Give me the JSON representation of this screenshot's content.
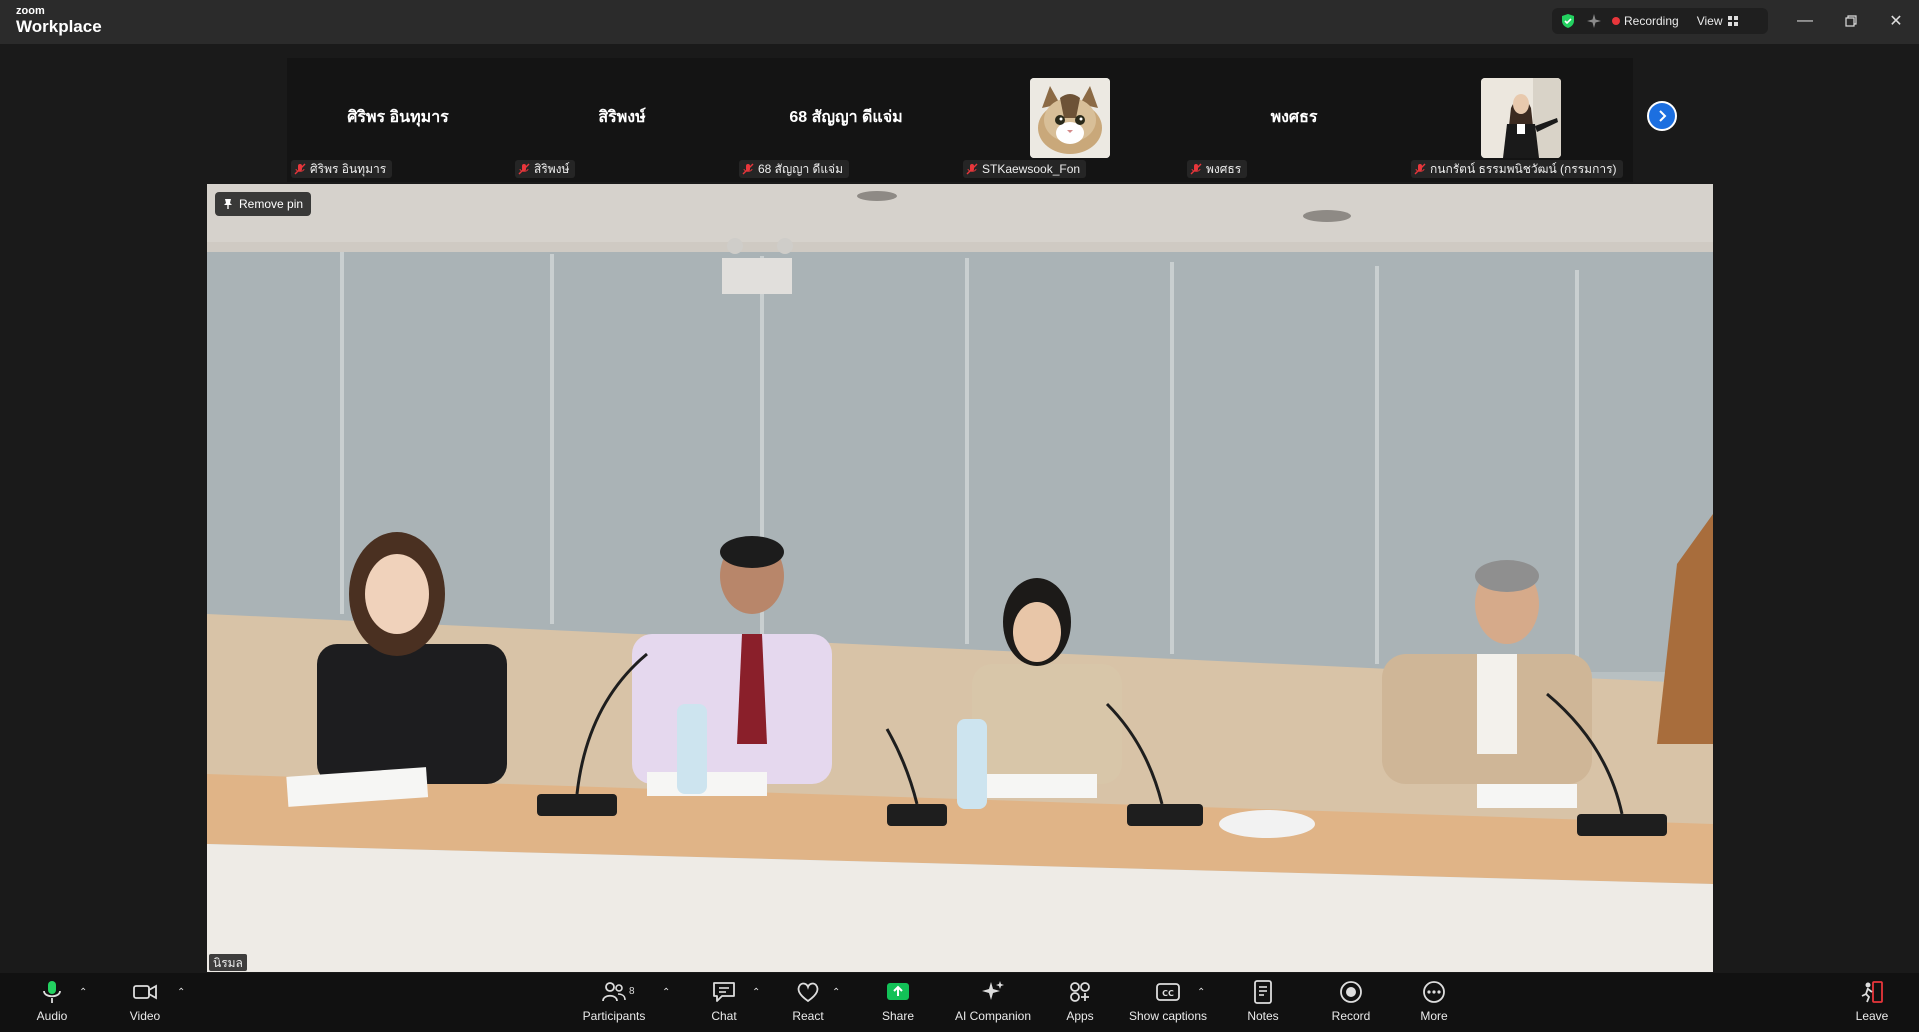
{
  "app": {
    "brand_small": "zoom",
    "brand_big": "Workplace"
  },
  "header": {
    "recording_label": "Recording",
    "view_label": "View"
  },
  "participants_strip": [
    {
      "center_name": "ศิริพร อินทุมาร",
      "label": "ศิริพร อินทุมาร",
      "has_photo": false
    },
    {
      "center_name": "สิริพงษ์",
      "label": "สิริพงษ์",
      "has_photo": false
    },
    {
      "center_name": "68 สัญญา ดีแจ่ม",
      "label": "68 สัญญา ดีแจ่ม",
      "has_photo": false
    },
    {
      "center_name": "",
      "label": "STKaewsook_Fon",
      "has_photo": true
    },
    {
      "center_name": "พงศธร",
      "label": "พงศธร",
      "has_photo": false
    },
    {
      "center_name": "",
      "label": "กนกรัตน์ ธรรมพนิชวัฒน์ (กรรมการ)",
      "has_photo": true
    }
  ],
  "main": {
    "remove_pin_label": "Remove pin",
    "speaker_name": "นิรมล"
  },
  "toolbar": {
    "audio": "Audio",
    "video": "Video",
    "participants": "Participants",
    "participants_count": "8",
    "chat": "Chat",
    "react": "React",
    "share": "Share",
    "ai_companion": "AI Companion",
    "apps": "Apps",
    "show_captions": "Show captions",
    "notes": "Notes",
    "record": "Record",
    "more": "More",
    "leave": "Leave"
  },
  "colors": {
    "accent_blue": "#1c6fe0",
    "share_green": "#12c157",
    "record_red": "#e8363b",
    "mic_green": "#23d160"
  }
}
